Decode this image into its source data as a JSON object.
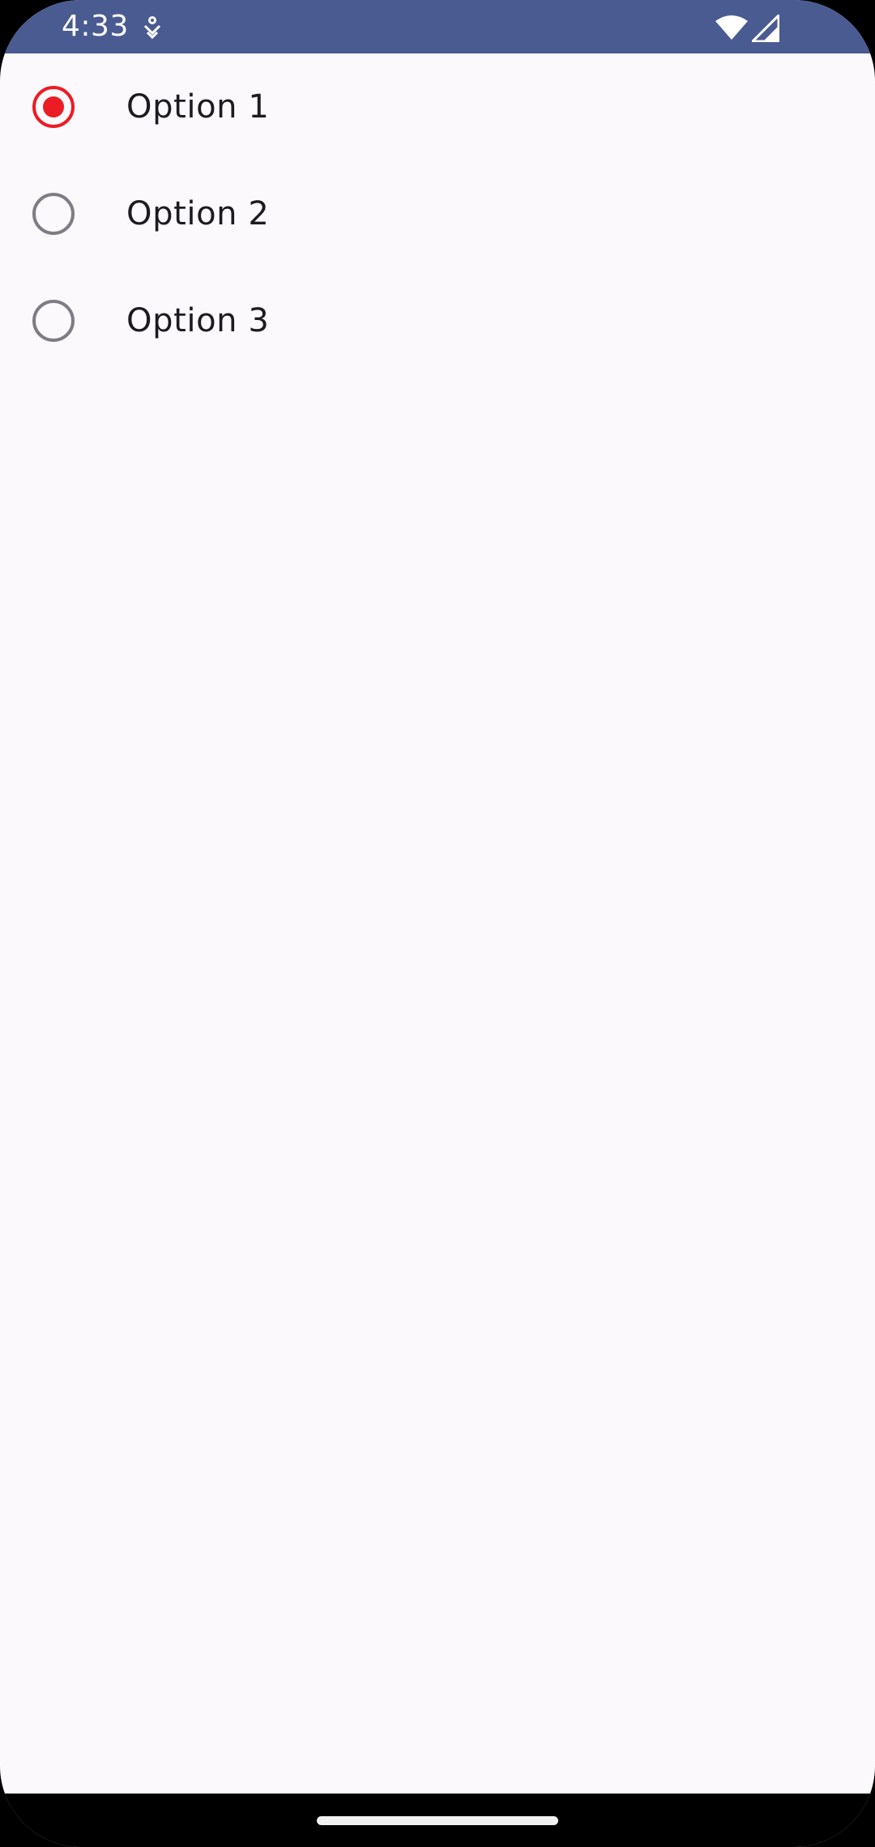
{
  "status_bar": {
    "time": "4:33",
    "background_color": "#4A5B92",
    "icons": [
      "notification-icon",
      "wifi-icon",
      "signal-icon"
    ]
  },
  "radio_group": {
    "accent_color": "#EC1C24",
    "options": [
      {
        "label": "Option 1",
        "selected": true
      },
      {
        "label": "Option 2",
        "selected": false
      },
      {
        "label": "Option 3",
        "selected": false
      }
    ]
  },
  "nav_bar": {
    "type": "gesture-handle"
  }
}
